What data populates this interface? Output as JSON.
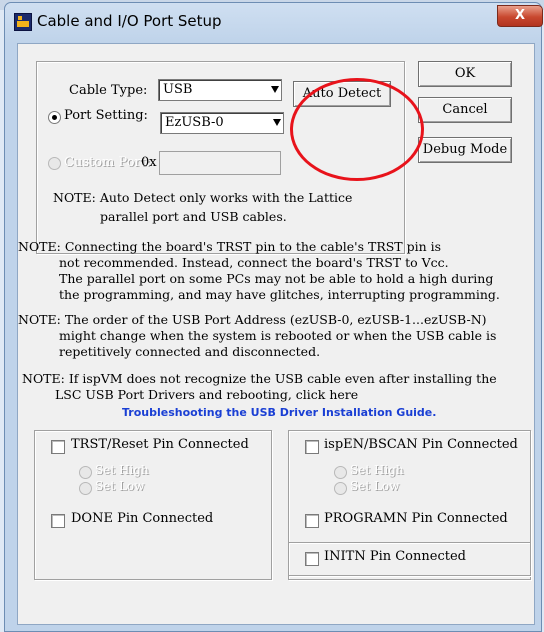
{
  "window": {
    "title": "Cable and I/O Port Setup",
    "close_label": "X"
  },
  "port_group": {
    "cable_type_label": "Cable Type:",
    "cable_type_value": "USB",
    "port_setting_label": "Port Setting:",
    "port_setting_value": "EzUSB-0",
    "custom_port_label": "Custom Port:",
    "custom_port_prefix": "0x",
    "custom_port_value": "",
    "auto_detect_label": "Auto Detect",
    "note_line1": "NOTE: Auto Detect only works with the Lattice",
    "note_line2": "parallel port and USB cables."
  },
  "buttons": {
    "ok": "OK",
    "cancel": "Cancel",
    "debug_mode": "Debug Mode"
  },
  "notes": {
    "trst": [
      "NOTE: Connecting the board's TRST pin to the cable's TRST pin is",
      "not recommended. Instead, connect the board's TRST to Vcc.",
      "The parallel port on some PCs may not be able to hold a high during",
      "the programming, and may have glitches, interrupting programming."
    ],
    "usb_order": [
      "NOTE: The order of the USB Port Address (ezUSB-0, ezUSB-1...ezUSB-N)",
      "might change when the system is rebooted or when the USB cable is",
      "repetitively connected and disconnected."
    ],
    "driver": [
      "NOTE: If ispVM does not recognize the USB cable even after installing the",
      "LSC USB Port Drivers and rebooting, click here"
    ],
    "link": "Troubleshooting the USB Driver Installation Guide."
  },
  "pins": {
    "trst": "TRST/Reset Pin Connected",
    "set_high": "Set High",
    "set_low": "Set Low",
    "done": "DONE Pin Connected",
    "ispen": "ispEN/BSCAN Pin Connected",
    "programn": "PROGRAMN Pin Connected",
    "initn": "INITN Pin Connected"
  },
  "colors": {
    "highlight_circle": "#e8131b",
    "link": "#1a3fd4",
    "close_button": "#c8482f"
  }
}
